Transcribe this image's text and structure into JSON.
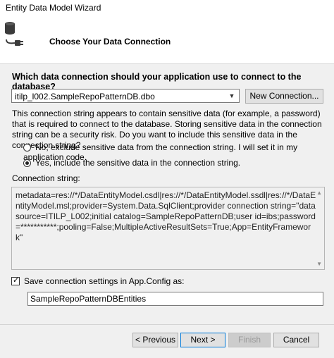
{
  "window": {
    "title": "Entity Data Model Wizard"
  },
  "header": {
    "title": "Choose Your Data Connection",
    "icon": "database-plug-icon"
  },
  "question": "Which data connection should your application use to connect to the database?",
  "connection": {
    "selected": "itilp_l002.SampleRepoPatternDB.dbo",
    "new_connection_label": "New Connection..."
  },
  "warning_text": "This connection string appears to contain sensitive data (for example, a password) that is required to connect to the database. Storing sensitive data in the connection string can be a security risk. Do you want to include this sensitive data in the connection string?",
  "options": {
    "no_label": "No, exclude sensitive data from the connection string. I will set it in my application code.",
    "yes_label": "Yes, include the sensitive data in the connection string.",
    "selected": "yes"
  },
  "connection_string": {
    "label": "Connection string:",
    "value": "metadata=res://*/DataEntityModel.csdl|res://*/DataEntityModel.ssdl|res://*/DataEntityModel.msl;provider=System.Data.SqlClient;provider connection string=\"data source=ITILP_L002;initial catalog=SampleRepoPatternDB;user id=ibs;password=***********;pooling=False;MultipleActiveResultSets=True;App=EntityFramework\""
  },
  "save_settings": {
    "label": "Save connection settings in App.Config as:",
    "checked": true,
    "value": "SampleRepoPatternDBEntities"
  },
  "buttons": {
    "previous": "< Previous",
    "next": "Next >",
    "finish": "Finish",
    "cancel": "Cancel"
  }
}
